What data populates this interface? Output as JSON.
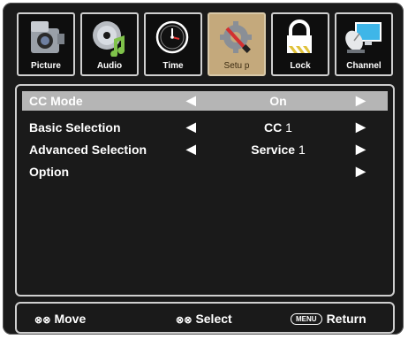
{
  "tabs": [
    {
      "label": "Picture",
      "icon": "camera-icon"
    },
    {
      "label": "Audio",
      "icon": "music-disc-icon"
    },
    {
      "label": "Time",
      "icon": "clock-icon"
    },
    {
      "label": "Setu p",
      "icon": "setup-gear-icon"
    },
    {
      "label": "Lock",
      "icon": "padlock-icon"
    },
    {
      "label": "Channel",
      "icon": "satellite-dish-icon"
    }
  ],
  "active_tab": "Setu p",
  "menu": {
    "rows": [
      {
        "label": "CC Mode",
        "value": "On",
        "value_num": ""
      },
      {
        "label": "Basic Selection",
        "value": "CC",
        "value_num": "1"
      },
      {
        "label": "Advanced Selection",
        "value": "Service",
        "value_num": "1"
      },
      {
        "label": "Option",
        "value": "",
        "value_num": ""
      }
    ],
    "selected_index": 0
  },
  "hints": {
    "move": "Move",
    "select": "Select",
    "menu_key": "MENU",
    "return": "Return"
  },
  "colors": {
    "background": "#1a1a1a",
    "selected_row": "#b5b5b5",
    "active_tab": "#c4a97c",
    "border": "#cfcfcf"
  }
}
